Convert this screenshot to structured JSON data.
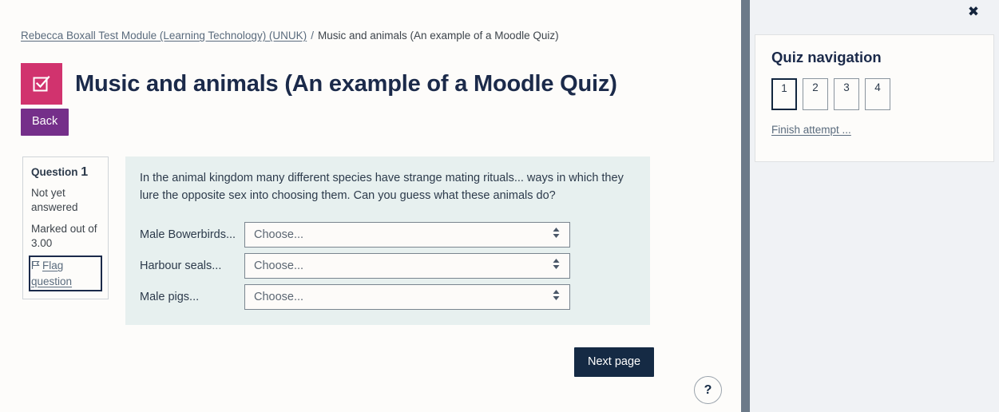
{
  "breadcrumb": {
    "course_link": "Rebecca Boxall Test Module (Learning Technology) (UNUK)",
    "separator": "/",
    "current": "Music and animals (An example of a Moodle Quiz)"
  },
  "header": {
    "title": "Music and animals (An example of a Moodle Quiz)",
    "icon": "quiz-checkbox-icon",
    "icon_color": "#d1336e"
  },
  "toolbar": {
    "back_label": "Back",
    "back_color": "#752f8a"
  },
  "question_info": {
    "question_word": "Question",
    "question_number": "1",
    "state": "Not yet answered",
    "grade": "Marked out of 3.00",
    "flag_label": "Flag question",
    "flag_icon": "flag-icon"
  },
  "question": {
    "text": "In the animal kingdom many different species have strange mating rituals... ways in which they lure the opposite sex into choosing them.  Can you guess what these animals do?",
    "background": "#e7f0ef",
    "rows": [
      {
        "label": "Male Bowerbirds...",
        "value": "Choose...",
        "placeholder": "Choose..."
      },
      {
        "label": "Harbour seals...",
        "value": "Choose...",
        "placeholder": "Choose..."
      },
      {
        "label": "Male pigs...",
        "value": "Choose...",
        "placeholder": "Choose..."
      }
    ]
  },
  "footer": {
    "next_page_label": "Next page",
    "next_page_color": "#152a44",
    "help_label": "?",
    "help_icon": "question-mark-icon"
  },
  "side_panel": {
    "close_icon": "close-icon",
    "close_label": "✖",
    "nav_title": "Quiz navigation",
    "question_buttons": [
      {
        "label": "1",
        "current": true
      },
      {
        "label": "2",
        "current": false
      },
      {
        "label": "3",
        "current": false
      },
      {
        "label": "4",
        "current": false
      }
    ],
    "finish_label": "Finish attempt ..."
  }
}
